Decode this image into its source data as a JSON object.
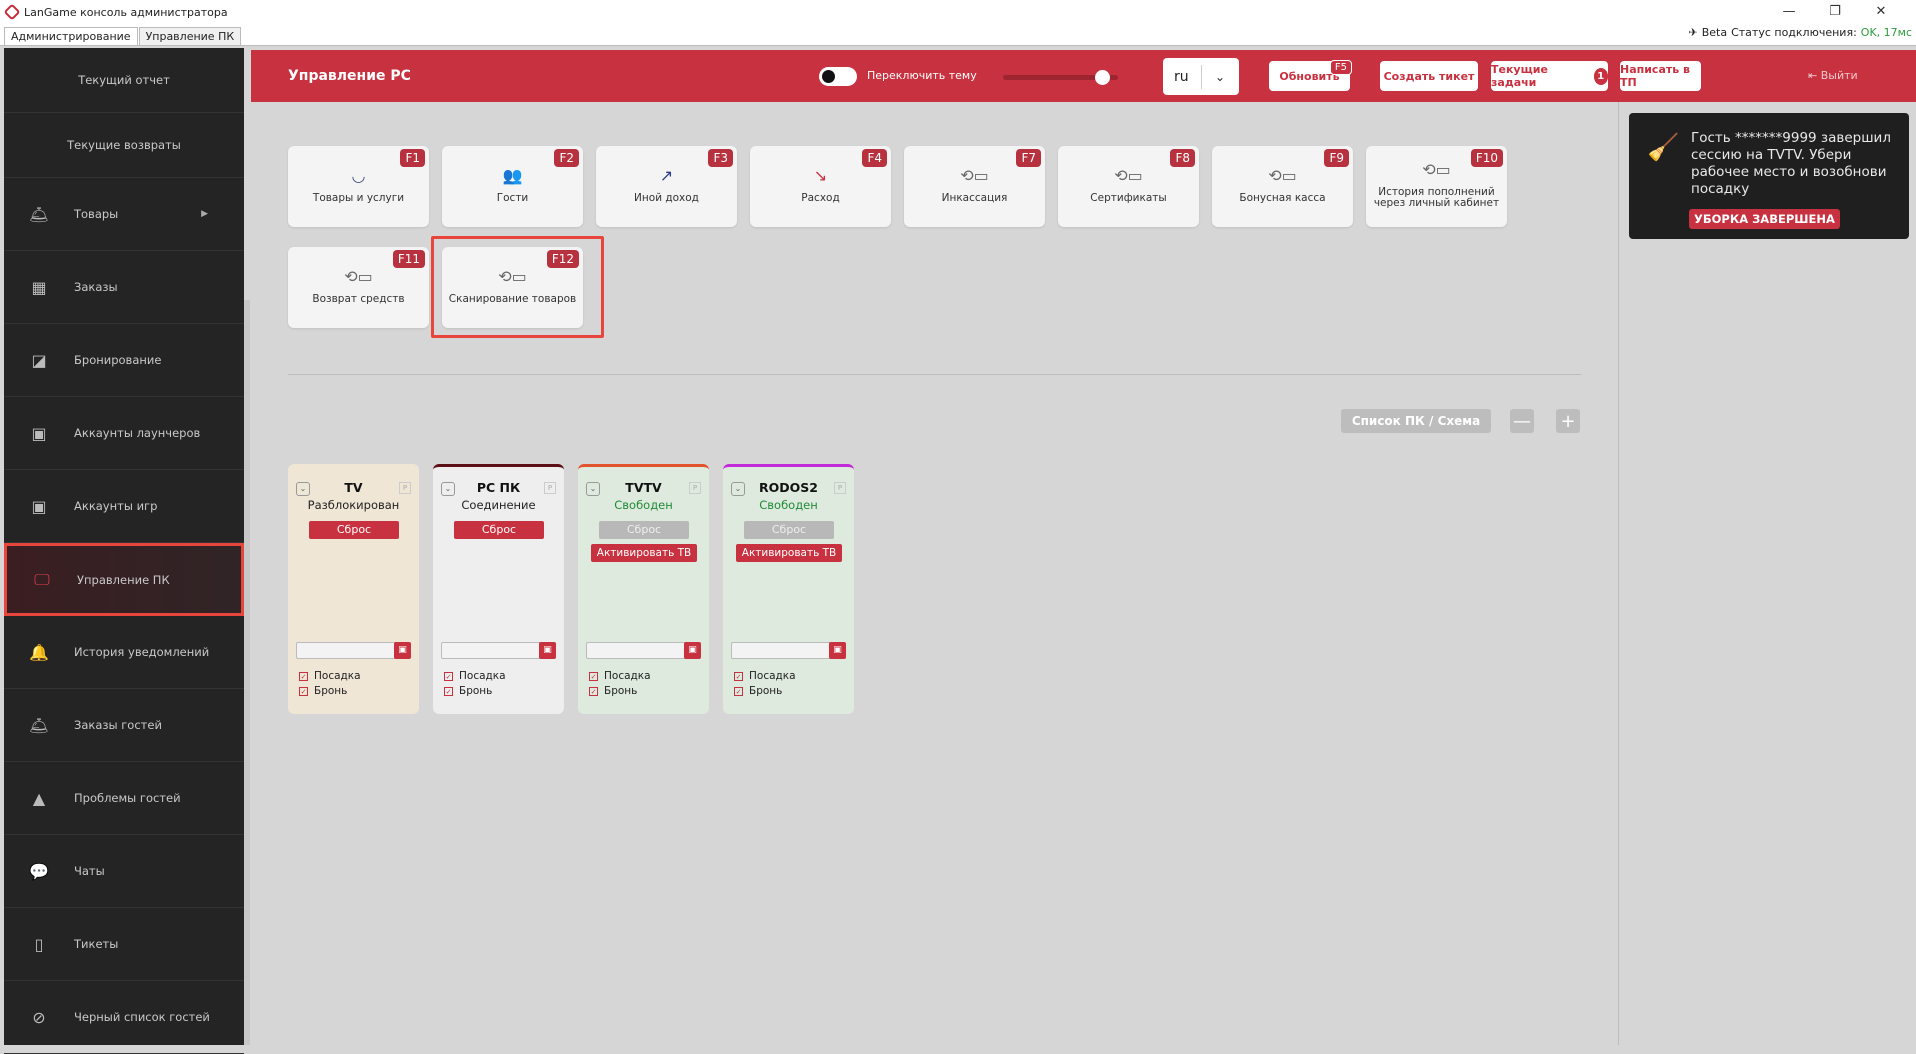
{
  "window": {
    "title": "LanGame консоль администратора",
    "controls": {
      "minimize": "—",
      "restore": "❐",
      "close": "✕"
    },
    "tabs": [
      {
        "label": "Администрирование",
        "active": true
      },
      {
        "label": "Управление ПК",
        "active": false
      }
    ],
    "status": {
      "beta": "Beta",
      "label": "Статус подключения:",
      "value": "OK, 17мс"
    }
  },
  "sidebar": {
    "items": [
      {
        "label": "Текущий отчет",
        "icon": "none"
      },
      {
        "label": "Текущие возвраты",
        "icon": "none"
      },
      {
        "label": "Товары",
        "icon": "cloche-icon",
        "arrow": "▶"
      },
      {
        "label": "Заказы",
        "icon": "grid-icon"
      },
      {
        "label": "Бронирование",
        "icon": "edit-icon"
      },
      {
        "label": "Аккаунты лаунчеров",
        "icon": "account-icon"
      },
      {
        "label": "Аккаунты игр",
        "icon": "account-icon"
      },
      {
        "label": "Управление ПК",
        "icon": "monitor-icon",
        "active": true
      },
      {
        "label": "История уведомлений",
        "icon": "bell-icon"
      },
      {
        "label": "Заказы гостей",
        "icon": "cloche-icon"
      },
      {
        "label": "Проблемы гостей",
        "icon": "warning-icon"
      },
      {
        "label": "Чаты",
        "icon": "chat-icon"
      },
      {
        "label": "Тикеты",
        "icon": "book-icon"
      },
      {
        "label": "Черный список гостей",
        "icon": "blocked-icon"
      }
    ]
  },
  "header": {
    "title": "Управление PC",
    "theme_toggle_label": "Переключить тему",
    "language": "ru",
    "refresh": {
      "label": "Обновить",
      "key": "F5"
    },
    "create_ticket": "Создать тикет",
    "current_tasks": {
      "label": "Текущие задачи",
      "count": "1"
    },
    "write_support": "Написать в ТП",
    "logout": "Выйти"
  },
  "quick_actions": [
    {
      "label": "Товары и услуги",
      "key": "F1",
      "icon": "bowl-icon"
    },
    {
      "label": "Гости",
      "key": "F2",
      "icon": "users-icon"
    },
    {
      "label": "Иной доход",
      "key": "F3",
      "icon": "trend-up-icon"
    },
    {
      "label": "Расход",
      "key": "F4",
      "icon": "trend-down-icon"
    },
    {
      "label": "Инкассация",
      "key": "F7",
      "icon": "cash-cycle-icon"
    },
    {
      "label": "Сертификаты",
      "key": "F8",
      "icon": "cash-cycle-icon"
    },
    {
      "label": "Бонусная касса",
      "key": "F9",
      "icon": "cash-cycle-icon"
    },
    {
      "label": "История пополнений через личный кабинет",
      "key": "F10",
      "icon": "cash-cycle-icon"
    },
    {
      "label": "Возврат средств",
      "key": "F11",
      "icon": "cash-cycle-icon"
    },
    {
      "label": "Сканирование товаров",
      "key": "F12",
      "icon": "cash-cycle-icon"
    }
  ],
  "view_controls": {
    "toggle_label": "Список ПК / Схема",
    "zoom_out": "—",
    "zoom_in": "+"
  },
  "pcs": [
    {
      "name": "TV",
      "status": "Разблокирован",
      "reset": "Сброс",
      "activate": "",
      "seat": "Посадка",
      "booking": "Бронь",
      "bg": "#efe6d6",
      "top": "#efe6d6",
      "status_color": "normal",
      "reset_enabled": true
    },
    {
      "name": "PC ПК",
      "status": "Соединение",
      "reset": "Сброс",
      "activate": "",
      "seat": "Посадка",
      "booking": "Бронь",
      "bg": "#eeeeee",
      "top": "#5b0f16",
      "status_color": "normal",
      "reset_enabled": true
    },
    {
      "name": "TVTV",
      "status": "Свободен",
      "reset": "Сброс",
      "activate": "Активировать ТВ",
      "seat": "Посадка",
      "booking": "Бронь",
      "bg": "#dfeadf",
      "top": "#e0532d",
      "status_color": "green",
      "reset_enabled": false
    },
    {
      "name": "RODOS2",
      "status": "Свободен",
      "reset": "Сброс",
      "activate": "Активировать ТВ",
      "seat": "Посадка",
      "booking": "Бронь",
      "bg": "#dfeadf",
      "top": "#c22bd8",
      "status_color": "green",
      "reset_enabled": false
    }
  ],
  "notification": {
    "text": "Гость *******9999 завершил сессию на TVTV. Убери рабочее место и возобнови посадку",
    "action": "УБОРКА ЗАВЕРШЕНА",
    "icon": "broom-icon"
  }
}
